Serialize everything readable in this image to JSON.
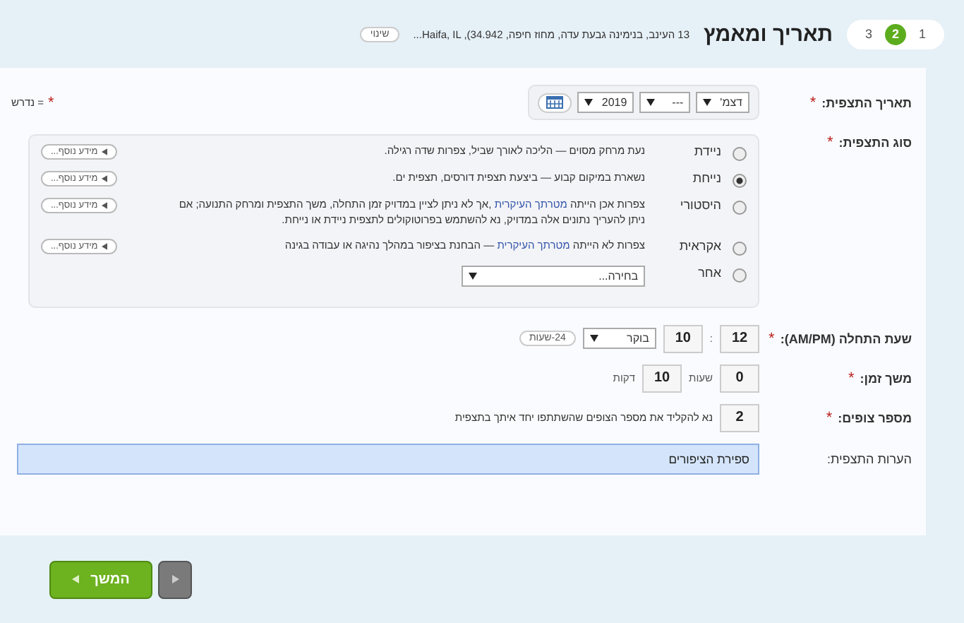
{
  "header": {
    "steps": [
      {
        "label": "1",
        "selected": false
      },
      {
        "label": "2",
        "selected": true
      },
      {
        "label": "3",
        "selected": false
      }
    ],
    "title": "תאריך ומאמץ",
    "location": "13 העינב, בנימינה גבעת עדה, מחוז חיפה, Haifa, IL ,(34.942...",
    "change_button": "שינוי"
  },
  "required_note": {
    "mark": "*",
    "text": "= נדרש"
  },
  "date": {
    "label": "תאריך התצפית:",
    "required_mark": "*",
    "month": "דצמ'",
    "day": "---",
    "year": "2019"
  },
  "observation_type": {
    "label": "סוג התצפית:",
    "required_mark": "*",
    "options": [
      {
        "kind": "description",
        "label": "ניידת",
        "selected": false,
        "description": {
          "before": "נעת מרחק מסוים — הליכה לאורך שביל, צפרות שדה רגילה."
        },
        "info_button": "מידע נוסף..."
      },
      {
        "kind": "description",
        "label": "נייחת",
        "selected": true,
        "description": {
          "before": "נשארת במיקום קבוע — ביצעת תצפית דורסים, תצפית ים."
        },
        "info_button": "מידע נוסף..."
      },
      {
        "kind": "description",
        "label": "היסטורי",
        "selected": false,
        "description": {
          "before": "צפרות אכן הייתה",
          "link": "מטרתך העיקרית",
          "after": ",אך לא ניתן לציין במדויק זמן התחלה, משך התצפית ומרחק התנועה; אם ניתן להעריך נתונים אלה במדויק, נא להשתמש בפרוטוקולים לתצפית ניידת או נייחת."
        },
        "info_button": "מידע נוסף..."
      },
      {
        "kind": "description",
        "label": "אקראית",
        "selected": false,
        "description": {
          "before": "צפרות לא הייתה",
          "link": "מטרתך העיקרית",
          "after": "— הבחנת בציפור במהלך נהיגה או עבודה בגינה"
        },
        "info_button": "מידע נוסף..."
      },
      {
        "kind": "select",
        "label": "אחר",
        "selected": false,
        "placeholder": "בחירה..."
      }
    ]
  },
  "start_time": {
    "label": "שעת התחלה (AM/PM):",
    "required_mark": "*",
    "hour": "12",
    "separator": ":",
    "minute": "10",
    "period": "בוקר",
    "clock_toggle": "24-שעות"
  },
  "duration": {
    "label": "משך זמן:",
    "required_mark": "*",
    "hours": "0",
    "hours_unit": "שעות",
    "minutes": "10",
    "minutes_unit": "דקות"
  },
  "observers": {
    "label": "מספר צופים:",
    "required_mark": "*",
    "value": "2",
    "hint": "נא להקליד את מספר הצופים שהשתתפו יחד איתך בתצפית"
  },
  "comments": {
    "label": "הערות התצפית:",
    "value": "ספירת הציפורים"
  },
  "footer": {
    "continue_button": "המשך",
    "back_disabled": true
  }
}
